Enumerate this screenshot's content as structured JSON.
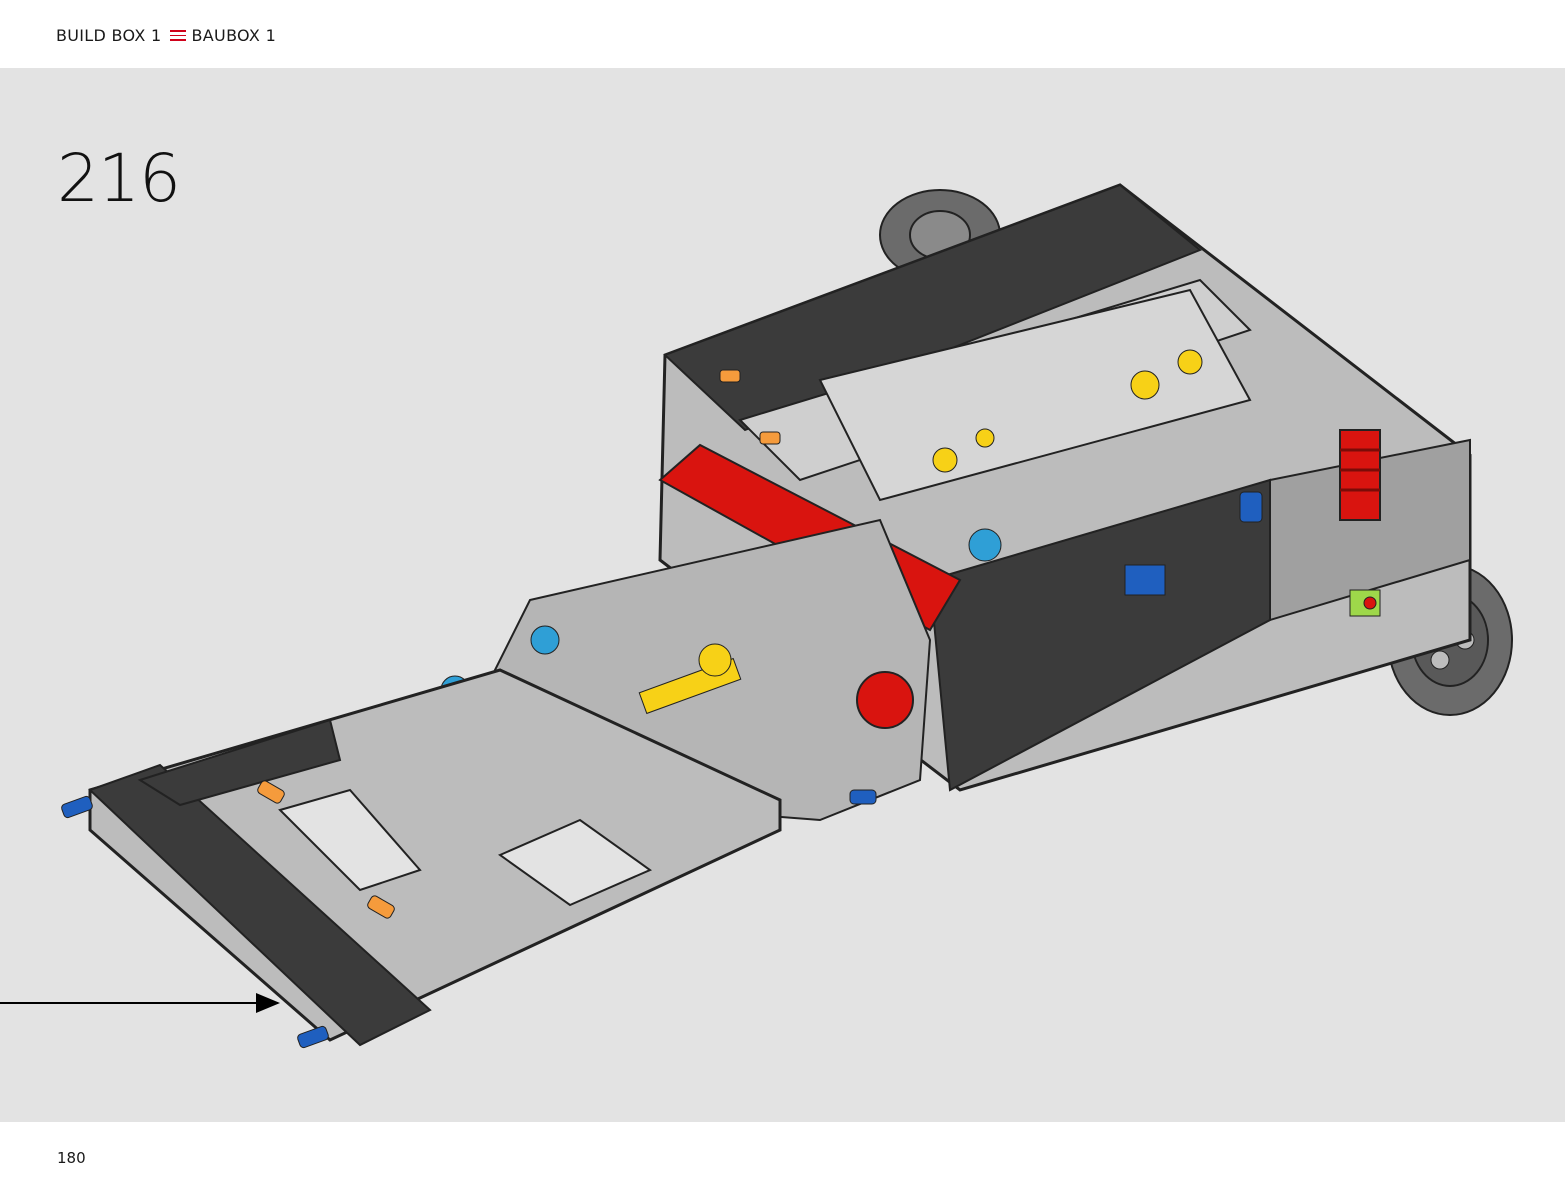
{
  "header": {
    "build_box_en": "BUILD BOX 1",
    "separator_icon": "three-red-lines-icon",
    "build_box_de": "BAUBOX 1"
  },
  "step": {
    "number": "216"
  },
  "footer": {
    "page_number": "180"
  },
  "colors": {
    "accent": "#d0021b",
    "canvas": "#e3e3e3",
    "beam_dark": "#3a3a3a",
    "beam_light": "#a9a9a9",
    "red": "#d9140f",
    "yellow": "#f7d117",
    "blue": "#1f5fbf",
    "orange": "#f59b3c",
    "lime": "#9ed84a"
  }
}
